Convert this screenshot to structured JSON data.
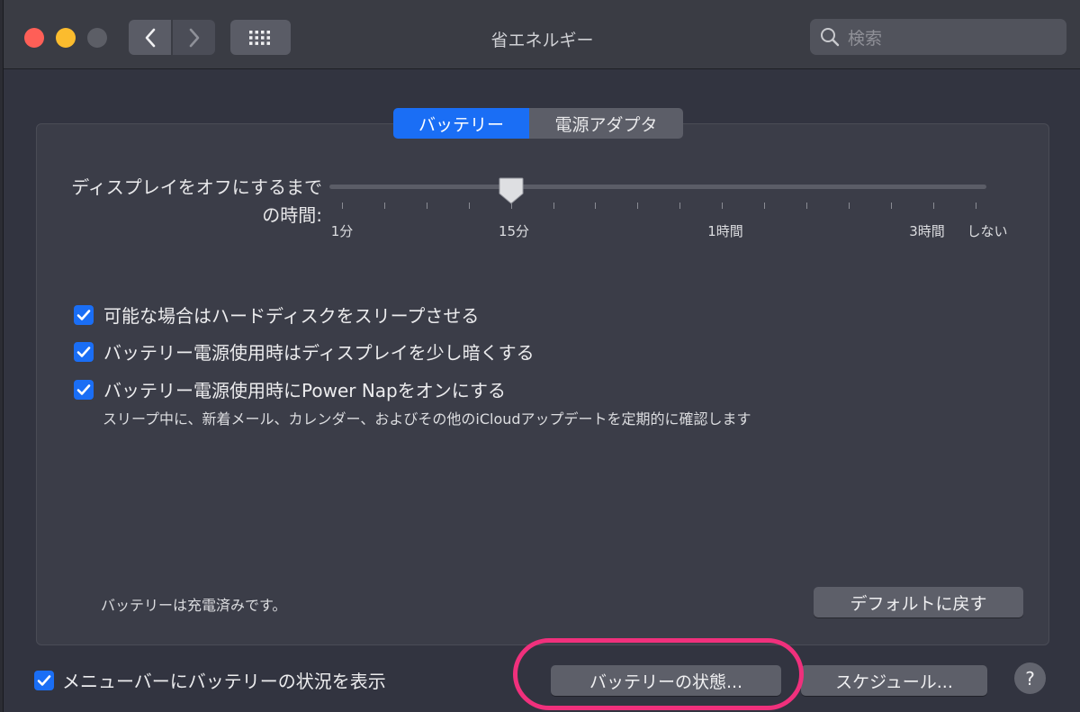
{
  "window": {
    "title": "省エネルギー"
  },
  "search": {
    "placeholder": "検索"
  },
  "tabs": [
    {
      "label": "バッテリー",
      "selected": true
    },
    {
      "label": "電源アダプタ",
      "selected": false
    }
  ],
  "display_sleep": {
    "label_line1": "ディスプレイをオフにするまで",
    "label_line2": "の時間:",
    "tick_labels": [
      "1分",
      "15分",
      "1時間",
      "3時間",
      "しない"
    ],
    "selected": "15分"
  },
  "options": [
    {
      "label": "可能な場合はハードディスクをスリープさせる",
      "checked": true
    },
    {
      "label": "バッテリー電源使用時はディスプレイを少し暗くする",
      "checked": true
    },
    {
      "label": "バッテリー電源使用時にPower Napをオンにする",
      "checked": true
    }
  ],
  "power_nap_note": "スリープ中に、新着メール、カレンダー、およびその他のiCloudアップデートを定期的に確認します",
  "battery_status": "バッテリーは充電済みです。",
  "buttons": {
    "restore_defaults": "デフォルトに戻す",
    "battery_health": "バッテリーの状態...",
    "schedule": "スケジュール...",
    "help": "?"
  },
  "menu_bar_option": {
    "label": "メニューバーにバッテリーの状況を表示",
    "checked": true
  },
  "colors": {
    "accent": "#1a6ef5",
    "highlight_ring": "#f0307c"
  }
}
